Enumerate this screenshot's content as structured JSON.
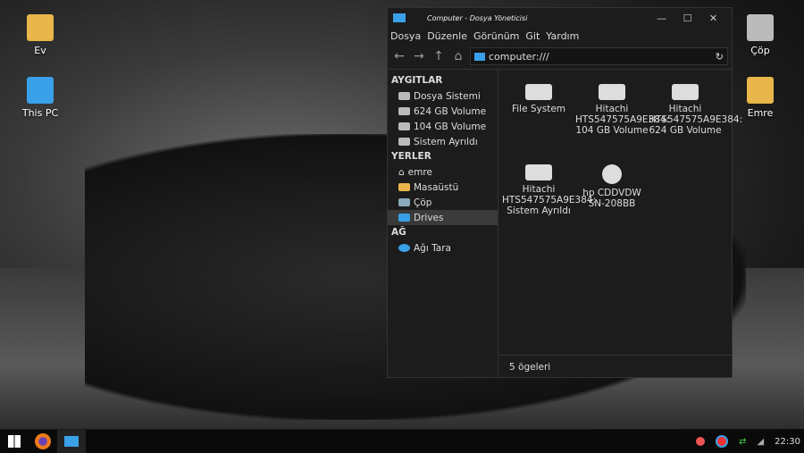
{
  "desktop": {
    "icons": [
      {
        "label": "Ev",
        "icon": "home-folder-icon"
      },
      {
        "label": "This PC",
        "icon": "computer-icon"
      },
      {
        "label": "Çöp",
        "icon": "trash-icon"
      },
      {
        "label": "Emre",
        "icon": "folder-icon"
      }
    ]
  },
  "window": {
    "title": "Computer - Dosya Yöneticisi",
    "menu": [
      "Dosya",
      "Düzenle",
      "Görünüm",
      "Git",
      "Yardım"
    ],
    "address": "computer:///",
    "sidebar": [
      {
        "header": "AYGITLAR",
        "items": [
          {
            "label": "Dosya Sistemi"
          },
          {
            "label": "624 GB Volume"
          },
          {
            "label": "104 GB Volume"
          },
          {
            "label": "Sistem Ayrıldı"
          }
        ]
      },
      {
        "header": "YERLER",
        "items": [
          {
            "label": "emre"
          },
          {
            "label": "Masaüstü"
          },
          {
            "label": "Çöp"
          },
          {
            "label": "Drives",
            "selected": true
          }
        ]
      },
      {
        "header": "AĞ",
        "items": [
          {
            "label": "Ağı Tara"
          }
        ]
      }
    ],
    "items": [
      {
        "label": "File System"
      },
      {
        "label": "Hitachi HTS547575A9E384: 104 GB Volume"
      },
      {
        "label": "Hitachi HTS547575A9E384: 624 GB Volume"
      },
      {
        "label": "Hitachi HTS547575A9E384: Sistem Ayrıldı"
      },
      {
        "label": "hp CDDVDW SN-208BB"
      }
    ],
    "status": "5 ögeleri"
  },
  "taskbar": {
    "clock": "22:30"
  },
  "colors": {
    "accent": "#1e88e5",
    "window_bg": "#1c1c1c"
  }
}
